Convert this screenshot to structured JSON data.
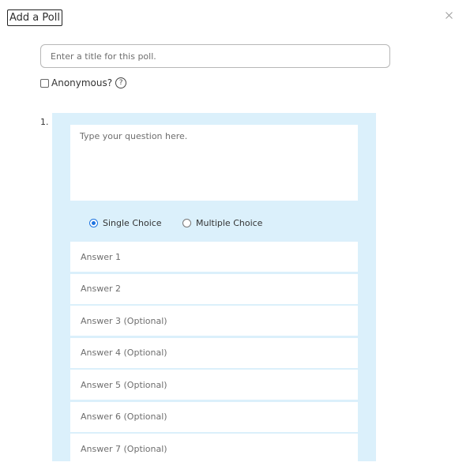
{
  "dialog": {
    "title": "Add a Poll",
    "close_symbol": "×"
  },
  "poll": {
    "title_placeholder": "Enter a title for this poll.",
    "anonymous_label": "Anonymous?",
    "help_symbol": "?"
  },
  "question": {
    "number": "1.",
    "placeholder": "Type your question here.",
    "choice_types": [
      {
        "label": "Single Choice",
        "selected": true
      },
      {
        "label": "Multiple Choice",
        "selected": false
      }
    ],
    "answers": [
      {
        "placeholder": "Answer 1"
      },
      {
        "placeholder": "Answer 2"
      },
      {
        "placeholder": "Answer 3 (Optional)"
      },
      {
        "placeholder": "Answer 4 (Optional)"
      },
      {
        "placeholder": "Answer 5 (Optional)"
      },
      {
        "placeholder": "Answer 6 (Optional)"
      },
      {
        "placeholder": "Answer 7 (Optional)"
      }
    ]
  },
  "colors": {
    "question_panel_bg": "#dbf0fb",
    "radio_accent": "#1f74e0"
  },
  "icons": [
    "close-icon",
    "help-icon",
    "checkbox-icon",
    "radio-icon"
  ]
}
